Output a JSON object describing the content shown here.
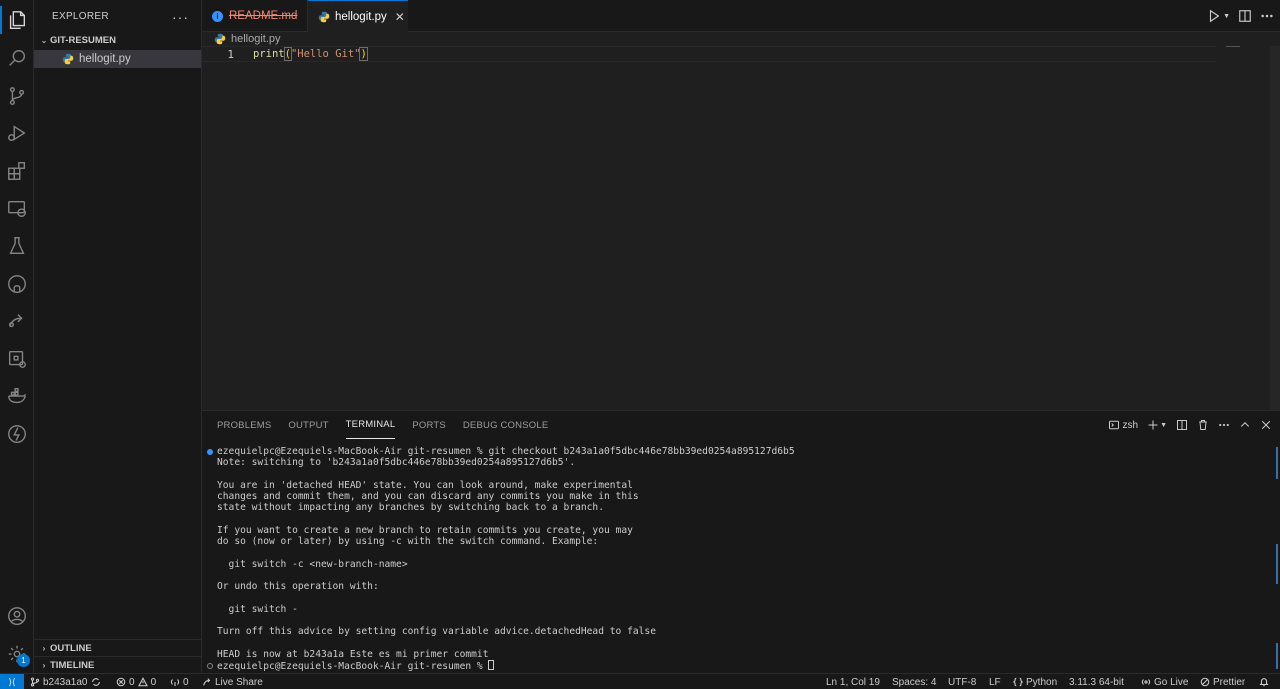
{
  "sidebar": {
    "title": "EXPLORER",
    "more": "···",
    "folder": "GIT-RESUMEN",
    "files": [
      {
        "name": "hellogit.py"
      }
    ],
    "outline": "OUTLINE",
    "timeline": "TIMELINE"
  },
  "activity": {
    "accounts_badge": "1"
  },
  "tabs": [
    {
      "label": "README.md",
      "state": "deleted"
    },
    {
      "label": "hellogit.py",
      "state": "active",
      "close": "✕"
    }
  ],
  "editor": {
    "breadcrumb": "hellogit.py",
    "line_number": "1",
    "code": {
      "fn": "print",
      "open": "(",
      "str": "\"Hello Git\"",
      "close": ")"
    }
  },
  "panel": {
    "tabs": [
      "PROBLEMS",
      "OUTPUT",
      "TERMINAL",
      "PORTS",
      "DEBUG CONSOLE"
    ],
    "active_tab": "TERMINAL",
    "shell": "zsh",
    "terminal_lines": [
      "ezequielpc@Ezequiels-MacBook-Air git-resumen % git checkout b243a1a0f5dbc446e78bb39ed0254a895127d6b5",
      "Note: switching to 'b243a1a0f5dbc446e78bb39ed0254a895127d6b5'.",
      "",
      "You are in 'detached HEAD' state. You can look around, make experimental",
      "changes and commit them, and you can discard any commits you make in this",
      "state without impacting any branches by switching back to a branch.",
      "",
      "If you want to create a new branch to retain commits you create, you may",
      "do so (now or later) by using -c with the switch command. Example:",
      "",
      "  git switch -c <new-branch-name>",
      "",
      "Or undo this operation with:",
      "",
      "  git switch -",
      "",
      "Turn off this advice by setting config variable advice.detachedHead to false",
      "",
      "HEAD is now at b243a1a Este es mi primer commit",
      "ezequielpc@Ezequiels-MacBook-Air git-resumen % "
    ]
  },
  "statusbar": {
    "remote": "⟩⟨",
    "branch": "b243a1a0",
    "errors": "0",
    "warnings": "0",
    "ports": "0",
    "live_share": "Live Share",
    "position": "Ln 1, Col 19",
    "spaces": "Spaces: 4",
    "encoding": "UTF-8",
    "eol": "LF",
    "language": "Python",
    "interpreter": "3.11.3 64-bit",
    "go_live": "Go Live",
    "prettier": "Prettier"
  },
  "colors": {
    "accent": "#0078d4",
    "deleted": "#f48771",
    "string": "#ce9178",
    "function": "#dcdcaa"
  }
}
